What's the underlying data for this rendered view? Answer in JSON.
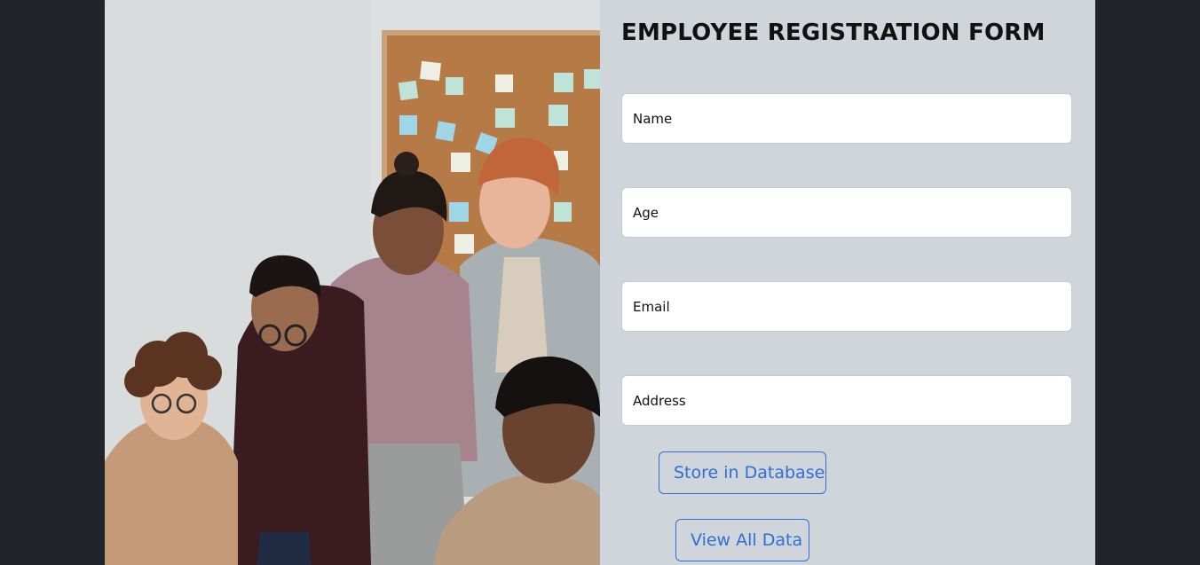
{
  "form": {
    "title": "EMPLOYEE REGISTRATION FORM",
    "fields": [
      {
        "placeholder": "Name"
      },
      {
        "placeholder": "Age"
      },
      {
        "placeholder": "Email"
      },
      {
        "placeholder": "Address"
      }
    ],
    "buttons": {
      "store_label": "Store in Database",
      "view_label": "View All Data"
    }
  },
  "colors": {
    "page_background": "#212529",
    "panel_background": "#d0d4db",
    "button_accent": "#2f6fd6"
  },
  "photo": {
    "icon": "team-photo"
  }
}
